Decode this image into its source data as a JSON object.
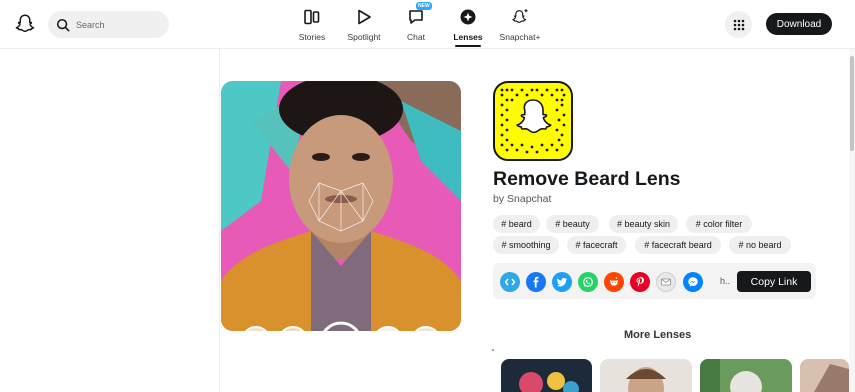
{
  "header": {
    "search_placeholder": "Search",
    "download_label": "Download",
    "nav": [
      {
        "label": "Stories",
        "icon": "stories-icon"
      },
      {
        "label": "Spotlight",
        "icon": "spotlight-icon"
      },
      {
        "label": "Chat",
        "icon": "chat-icon",
        "badge": "NEW"
      },
      {
        "label": "Lenses",
        "icon": "lenses-icon",
        "active": true
      },
      {
        "label": "Snapchat+",
        "icon": "snapchat-plus-icon"
      }
    ]
  },
  "lens": {
    "title": "Remove Beard Lens",
    "creator": "by Snapchat",
    "tags": [
      "# beard",
      "# beauty",
      "# beauty skin",
      "# color filter",
      "# smoothing",
      "# facecraft",
      "# facecraft beard",
      "# no beard"
    ]
  },
  "share": {
    "icons": [
      "embed-icon",
      "facebook-icon",
      "twitter-icon",
      "whatsapp-icon",
      "reddit-icon",
      "pinterest-icon",
      "email-icon",
      "messenger-icon"
    ],
    "link_truncated": "h..",
    "copy_label": "Copy Link"
  },
  "more_lenses": {
    "title": "More Lenses"
  },
  "colors": {
    "snap_yellow": "#FFFC00",
    "dark": "#16191C",
    "facebook": "#1877F2",
    "twitter": "#1DA1F2",
    "whatsapp": "#25D366",
    "reddit": "#FF4500",
    "pinterest": "#E60023",
    "messenger": "#0084FF"
  }
}
